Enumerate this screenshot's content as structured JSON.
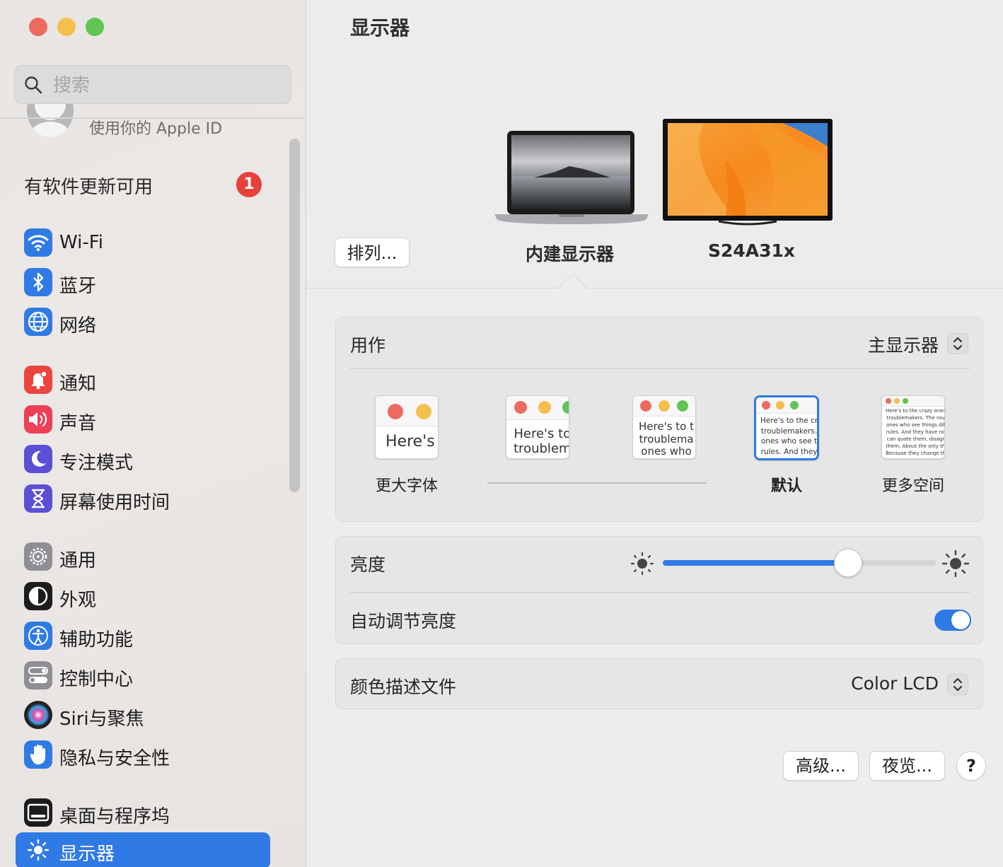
{
  "window": {
    "title": "显示器"
  },
  "sidebar": {
    "search": {
      "placeholder": "搜索",
      "value": ""
    },
    "apple_id_text": "使用你的 Apple ID",
    "update": {
      "label": "有软件更新可用",
      "badge": "1"
    },
    "items": [
      {
        "label": "Wi-Fi",
        "icon": "wifi-icon",
        "color": "#3b82f6"
      },
      {
        "label": "蓝牙",
        "icon": "bluetooth-icon",
        "color": "#3b82f6"
      },
      {
        "label": "网络",
        "icon": "globe-icon",
        "color": "#3b82f6"
      },
      {
        "label": "通知",
        "icon": "bell-icon",
        "color": "#ef4444"
      },
      {
        "label": "声音",
        "icon": "speaker-icon",
        "color": "#ec4057"
      },
      {
        "label": "专注模式",
        "icon": "moon-icon",
        "color": "#5b4fd6"
      },
      {
        "label": "屏幕使用时间",
        "icon": "hourglass-icon",
        "color": "#5b4fd6"
      },
      {
        "label": "通用",
        "icon": "gear-icon",
        "color": "#8e8e93"
      },
      {
        "label": "外观",
        "icon": "appearance-icon",
        "color": "#1c1c1e"
      },
      {
        "label": "辅助功能",
        "icon": "accessibility-icon",
        "color": "#2f7ae5"
      },
      {
        "label": "控制中心",
        "icon": "toggles-icon",
        "color": "#8e8e93"
      },
      {
        "label": "Siri与聚焦",
        "icon": "siri-icon",
        "color": "#2b2b3b"
      },
      {
        "label": "隐私与安全性",
        "icon": "hand-icon",
        "color": "#3b82f6"
      },
      {
        "label": "桌面与程序坞",
        "icon": "dock-icon",
        "color": "#1c1c1e"
      },
      {
        "label": "显示器",
        "icon": "sun-icon",
        "color": "#2f7ae5",
        "selected": true
      }
    ]
  },
  "main": {
    "arrange_button": "排列...",
    "displays": [
      {
        "name": "内建显示器",
        "selected": true
      },
      {
        "name": "S24A31x",
        "selected": false
      }
    ],
    "use_as": {
      "label": "用作",
      "value": "主显示器"
    },
    "resolution_options": [
      {
        "label": "更大字体",
        "preview_text": "Here's"
      },
      {
        "label": "",
        "preview_text": "Here's to\ntroublem"
      },
      {
        "label": "",
        "preview_text": "Here's to t\ntroublema\nones who"
      },
      {
        "label": "默认",
        "preview_text": "Here's to the cr\ntroublemakers.\nones who see t\nrules. And they",
        "selected": true
      },
      {
        "label": "更多空间",
        "preview_text": "Here's to the crazy ones\ntroublemakers. The rou\nones who see things dif\nrules. And they have no\ncan quote them, disagr\nthem. About the only th\nBecause they change th"
      }
    ],
    "brightness": {
      "label": "亮度",
      "value": 0.68
    },
    "auto_brightness": {
      "label": "自动调节亮度",
      "on": true
    },
    "color_profile": {
      "label": "颜色描述文件",
      "value": "Color LCD"
    },
    "buttons": {
      "advanced": "高级...",
      "night_shift": "夜览...",
      "help": "?"
    }
  },
  "colors": {
    "accent": "#2f7ae5",
    "badge": "#e8403a",
    "traffic_close": "#ed6a5e",
    "traffic_minimize": "#f5bf4f",
    "traffic_zoom": "#61c554"
  }
}
